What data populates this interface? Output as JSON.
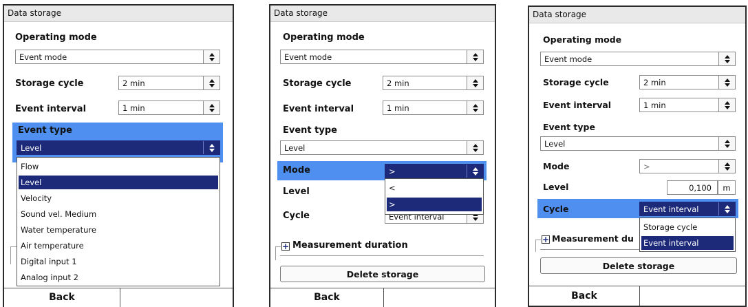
{
  "panels": [
    {
      "title": "Data storage",
      "operating_mode_label": "Operating mode",
      "operating_mode_value": "Event mode",
      "storage_cycle_label": "Storage cycle",
      "storage_cycle_value": "2 min",
      "event_interval_label": "Event interval",
      "event_interval_value": "1 min",
      "event_type_label": "Event type",
      "event_type_value": "Level",
      "event_type_options": [
        "Flow",
        "Level",
        "Velocity",
        "Sound vel. Medium",
        "Water temperature",
        "Air temperature",
        "Digital input 1",
        "Analog input 2"
      ],
      "event_type_selected_index": 1,
      "back_label": "Back"
    },
    {
      "title": "Data storage",
      "operating_mode_label": "Operating mode",
      "operating_mode_value": "Event mode",
      "storage_cycle_label": "Storage cycle",
      "storage_cycle_value": "2 min",
      "event_interval_label": "Event interval",
      "event_interval_value": "1 min",
      "event_type_label": "Event type",
      "event_type_value": "Level",
      "mode_label": "Mode",
      "mode_value": ">",
      "mode_options": [
        "<",
        ">"
      ],
      "mode_selected_index": 1,
      "level_label": "Level",
      "cycle_label": "Cycle",
      "cycle_value": "Event interval",
      "measurement_duration_label": "Measurement duration",
      "delete_storage_label": "Delete storage",
      "back_label": "Back"
    },
    {
      "title": "Data storage",
      "operating_mode_label": "Operating mode",
      "operating_mode_value": "Event mode",
      "storage_cycle_label": "Storage cycle",
      "storage_cycle_value": "2 min",
      "event_interval_label": "Event interval",
      "event_interval_value": "1 min",
      "event_type_label": "Event type",
      "event_type_value": "Level",
      "mode_label": "Mode",
      "mode_value": ">",
      "level_label": "Level",
      "level_value": "0,100",
      "level_unit": "m",
      "cycle_label": "Cycle",
      "cycle_value": "Event interval",
      "cycle_options": [
        "Storage cycle",
        "Event interval"
      ],
      "cycle_selected_index": 1,
      "measurement_duration_label": "Measurement du",
      "delete_storage_label": "Delete storage",
      "back_label": "Back"
    }
  ],
  "colors": {
    "highlight": "#4f8ff0",
    "selected": "#1d2a7a",
    "title_bar": "#e9e9e9"
  },
  "icons": {
    "spinner": "up-down-arrows-icon",
    "expand": "plus-icon"
  }
}
